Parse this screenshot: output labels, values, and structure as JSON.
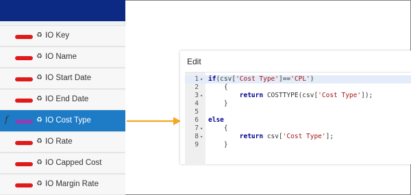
{
  "fields": [
    {
      "label": "IO Key",
      "selected": false
    },
    {
      "label": "IO Name",
      "selected": false
    },
    {
      "label": "IO Start Date",
      "selected": false
    },
    {
      "label": "IO End Date",
      "selected": false
    },
    {
      "label": "IO Cost Type",
      "selected": true,
      "fx_label": "f"
    },
    {
      "label": "IO Rate",
      "selected": false
    },
    {
      "label": "IO Capped Cost",
      "selected": false
    },
    {
      "label": "IO Margin Rate",
      "selected": false
    }
  ],
  "field_icon": "recycle-icon",
  "colors": {
    "header": "#0c2a84",
    "selected_row": "#1e7cc7",
    "pill": "#e0191b",
    "pill_selected": "#8b3fb5",
    "arrow": "#f5a623"
  },
  "edit": {
    "title": "Edit",
    "lines": [
      {
        "num": "1",
        "fold": "▾",
        "text": "if(csv['Cost Type']=='CPL')"
      },
      {
        "num": "2",
        "fold": "",
        "text": "    {"
      },
      {
        "num": "3",
        "fold": "▾",
        "text": "        return COSTTYPE(csv['Cost Type']);"
      },
      {
        "num": "4",
        "fold": "",
        "text": "    }"
      },
      {
        "num": "5",
        "fold": "",
        "text": ""
      },
      {
        "num": "6",
        "fold": "",
        "text": "else"
      },
      {
        "num": "7",
        "fold": "▾",
        "text": "    {"
      },
      {
        "num": "8",
        "fold": "▾",
        "text": "        return csv['Cost Type'];"
      },
      {
        "num": "9",
        "fold": "",
        "text": "    }"
      }
    ]
  }
}
